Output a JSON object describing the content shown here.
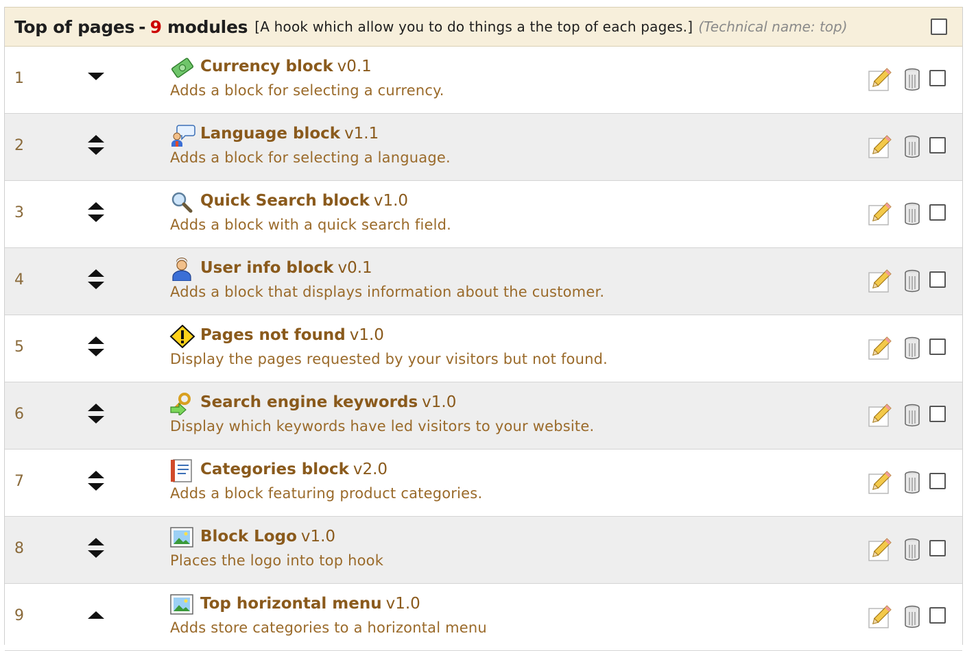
{
  "hook": {
    "title": "Top of pages",
    "dash": "-",
    "count": "9",
    "modules_word": "modules",
    "description": "[A hook which allow you to do things a the top of each pages.]",
    "technical": "(Technical name: top)"
  },
  "colors": {
    "header_bg": "#f7efdb",
    "module_name": "#8a5a1c",
    "count": "#cc0000",
    "alt_row": "#eeeeee"
  },
  "modules": [
    {
      "position": "1",
      "name": "Currency block",
      "version": "v0.1",
      "desc": "Adds a block for selecting a currency.",
      "icon": "currency-icon",
      "arrows": "down"
    },
    {
      "position": "2",
      "name": "Language block",
      "version": "v1.1",
      "desc": "Adds a block for selecting a language.",
      "icon": "language-icon",
      "arrows": "both"
    },
    {
      "position": "3",
      "name": "Quick Search block",
      "version": "v1.0",
      "desc": "Adds a block with a quick search field.",
      "icon": "search-icon",
      "arrows": "both"
    },
    {
      "position": "4",
      "name": "User info block",
      "version": "v0.1",
      "desc": "Adds a block that displays information about the customer.",
      "icon": "user-icon",
      "arrows": "both"
    },
    {
      "position": "5",
      "name": "Pages not found",
      "version": "v1.0",
      "desc": "Display the pages requested by your visitors but not found.",
      "icon": "warning-icon",
      "arrows": "both"
    },
    {
      "position": "6",
      "name": "Search engine keywords",
      "version": "v1.0",
      "desc": "Display which keywords have led visitors to your website.",
      "icon": "key-icon",
      "arrows": "both"
    },
    {
      "position": "7",
      "name": "Categories block",
      "version": "v2.0",
      "desc": "Adds a block featuring product categories.",
      "icon": "notebook-icon",
      "arrows": "both"
    },
    {
      "position": "8",
      "name": "Block Logo",
      "version": "v1.0",
      "desc": "Places the logo into top hook",
      "icon": "picture-icon",
      "arrows": "both"
    },
    {
      "position": "9",
      "name": "Top horizontal menu",
      "version": "v1.0",
      "desc": "Adds store categories to a horizontal menu",
      "icon": "picture-icon",
      "arrows": "up"
    }
  ]
}
